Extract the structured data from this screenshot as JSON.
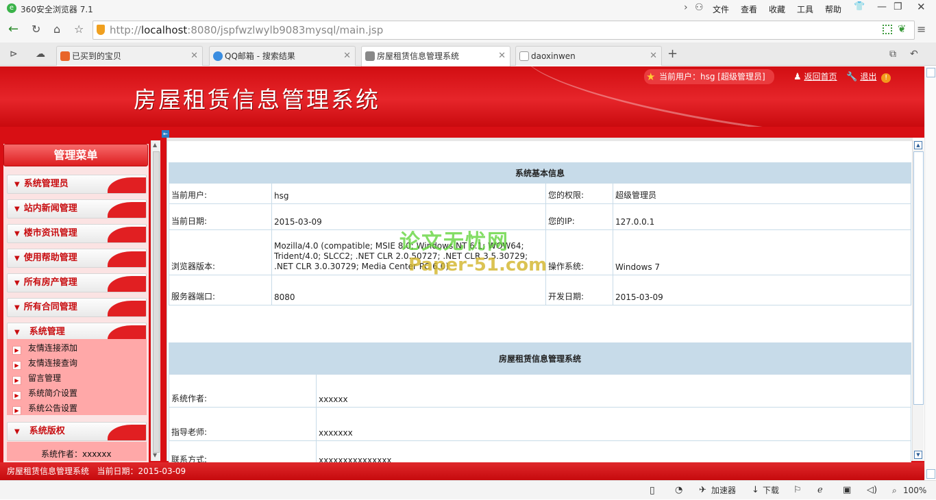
{
  "browser": {
    "title": "360安全浏览器 7.1",
    "menu": [
      "文件",
      "查看",
      "收藏",
      "工具",
      "帮助"
    ],
    "url_prefix": "http://",
    "url_host": "localhost",
    "url_path": ":8080/jspfwzlwylb9083mysql/main.jsp",
    "tabs": [
      {
        "label": "已买到的宝贝",
        "color": "#e8652a"
      },
      {
        "label": "QQ邮箱 - 搜索结果",
        "color": "#3a8de0"
      },
      {
        "label": "房屋租赁信息管理系统",
        "color": "#888888"
      },
      {
        "label": "daoxinwen",
        "color": "#bbbbbb"
      }
    ],
    "status": {
      "accelerator": "加速器",
      "download": "下载",
      "zoom": "100%"
    }
  },
  "header": {
    "system_name": "房屋租赁信息管理系统",
    "user_label": "当前用户：hsg [超级管理员]",
    "home_link": "返回首页",
    "logout_link": "退出"
  },
  "sidebar": {
    "title": "管理菜单",
    "items": [
      "系统管理员",
      "站内新闻管理",
      "楼市资讯管理",
      "使用帮助管理",
      "所有房产管理",
      "所有合同管理",
      "系统管理"
    ],
    "sub_items": [
      "友情连接添加",
      "友情连接查询",
      "留言管理",
      "系统简介设置",
      "系统公告设置"
    ],
    "copyright_title": "系统版权",
    "author_line": "系统作者：xxxxxx"
  },
  "info": {
    "title": "系统基本信息",
    "current_user_label": "当前用户:",
    "current_user": "hsg",
    "rights_label": "您的权限:",
    "rights": "超级管理员",
    "date_label": "当前日期:",
    "date": "2015-03-09",
    "ip_label": "您的IP:",
    "ip": "127.0.0.1",
    "browser_label": "浏览器版本:",
    "browser_version": "Mozilla/4.0 (compatible; MSIE 8.0; Windows NT 6.1; WOW64; Trident/4.0; SLCC2; .NET CLR 2.0.50727; .NET CLR 3.5.30729; .NET CLR 3.0.30729; Media Center PC 6.0)",
    "os_label": "操作系统:",
    "os": "Windows 7",
    "port_label": "服务器端口:",
    "port": "8080",
    "dev_date_label": "开发日期:",
    "dev_date": "2015-03-09"
  },
  "about": {
    "title": "房屋租赁信息管理系统",
    "author_label": "系统作者:",
    "author": "xxxxxx",
    "teacher_label": "指导老师:",
    "teacher": "xxxxxxx",
    "contact_label": "联系方式:",
    "contact": "xxxxxxxxxxxxxxx"
  },
  "footer": "房屋租赁信息管理系统   当前日期：2015-03-09",
  "watermark": {
    "line1": "论文无忧网",
    "line2": "Paper-51.com"
  }
}
